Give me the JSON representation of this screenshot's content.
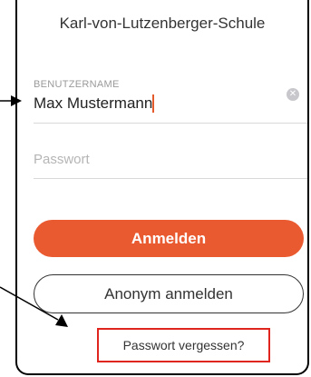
{
  "login": {
    "school_name": "Karl-von-Lutzenberger-Schule",
    "username_label": "BENUTZERNAME",
    "username_value": "Max Mustermann",
    "password_placeholder": "Passwort",
    "login_button": "Anmelden",
    "anonymous_button": "Anonym anmelden",
    "forgot_password": "Passwort vergessen?"
  },
  "colors": {
    "accent": "#ea5a30",
    "highlight_box": "#e0251f"
  },
  "icons": {
    "clear": "clear-circle-icon"
  }
}
